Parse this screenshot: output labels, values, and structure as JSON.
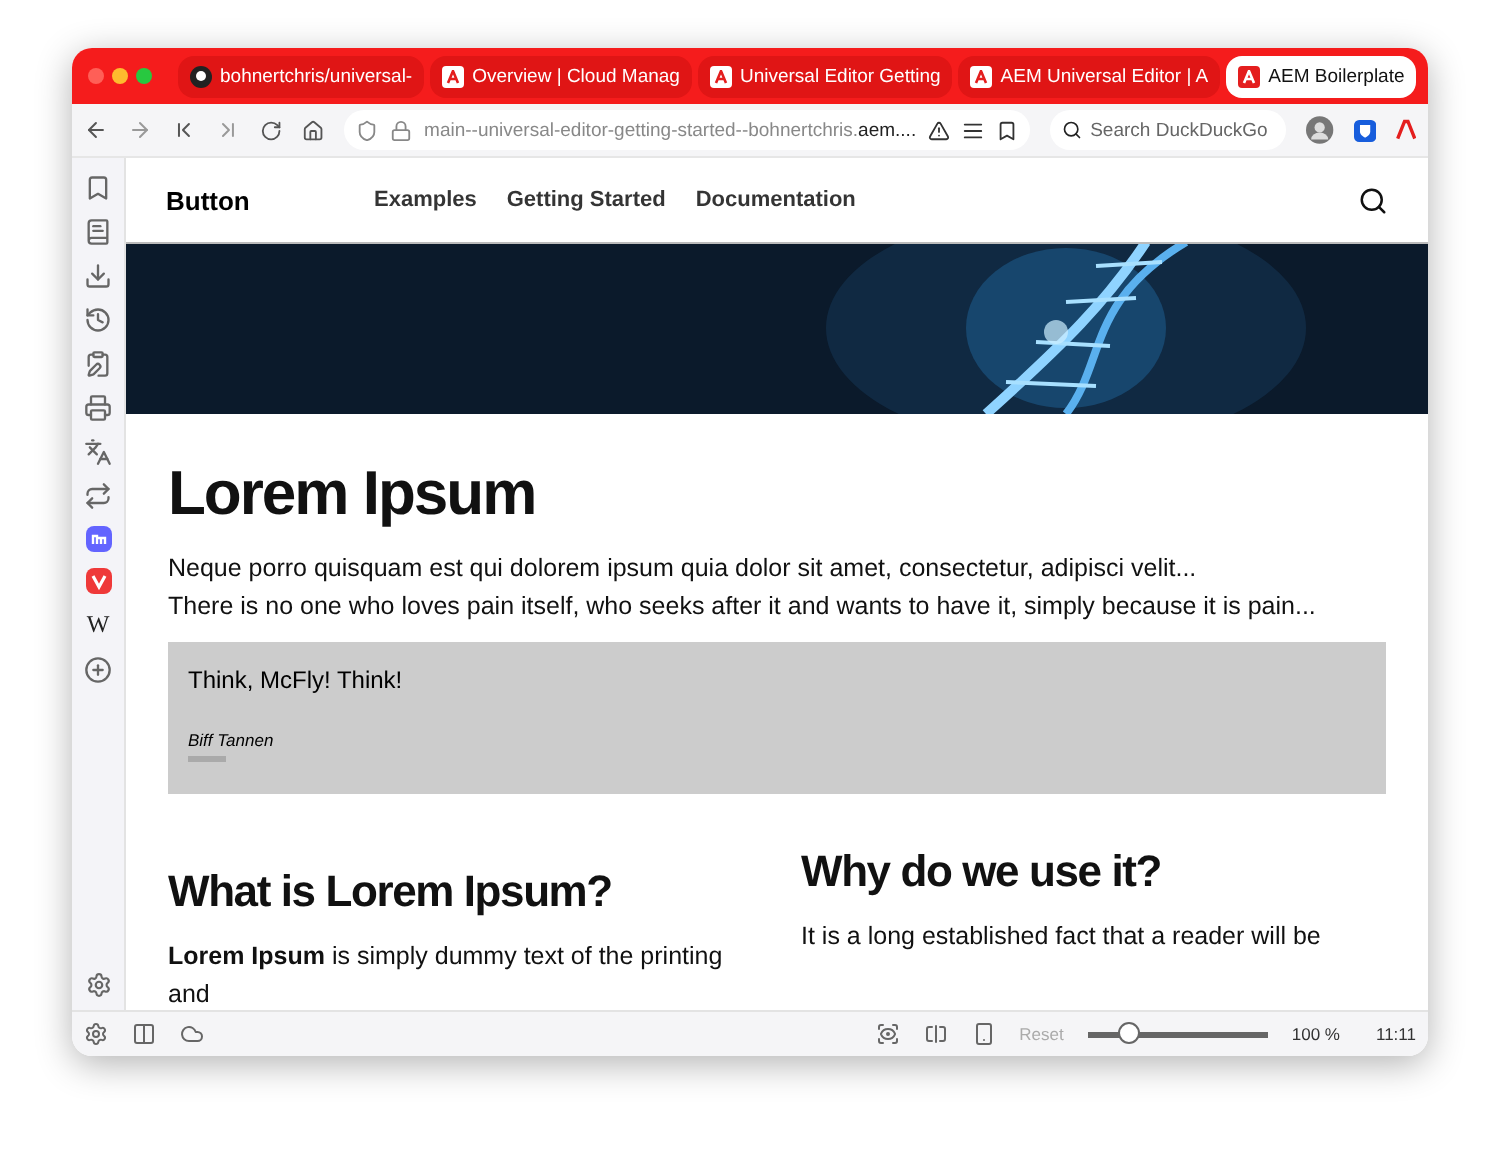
{
  "tabs": [
    {
      "label": "bohnertchris/universal-",
      "selected": false
    },
    {
      "label": "Overview | Cloud Manag",
      "selected": false
    },
    {
      "label": "Universal Editor Getting",
      "selected": false
    },
    {
      "label": "AEM Universal Editor | A",
      "selected": false
    },
    {
      "label": "AEM Boilerplate",
      "selected": true
    }
  ],
  "address": {
    "url_start": "main--universal-editor-getting-started--bohnertchris.",
    "url_end": "aem...."
  },
  "search": {
    "placeholder": "Search DuckDuckGo"
  },
  "sidebar": [
    {
      "kind": "bookmarks"
    },
    {
      "kind": "reading"
    },
    {
      "kind": "downloads"
    },
    {
      "kind": "history"
    },
    {
      "kind": "notes"
    },
    {
      "kind": "print"
    },
    {
      "kind": "translate"
    },
    {
      "kind": "sync"
    },
    {
      "kind": "mastodon"
    },
    {
      "kind": "vivaldi"
    },
    {
      "kind": "wiki",
      "glyph": "W"
    },
    {
      "kind": "add"
    }
  ],
  "site": {
    "title": "Button",
    "nav": [
      "Examples",
      "Getting Started",
      "Documentation"
    ]
  },
  "page": {
    "heading": "Lorem Ipsum",
    "paragraphs": [
      "Neque porro quisquam est qui dolorem ipsum quia dolor sit amet, consectetur, adipisci velit...",
      "There is no one who loves pain itself, who seeks after it and wants to have it, simply because it is pain..."
    ],
    "quote": {
      "text": "Think, McFly! Think!",
      "author": "Biff Tannen"
    },
    "columns": [
      {
        "heading": "What is Lorem Ipsum?",
        "text": "**Lorem Ipsum**  is simply dummy text of the printing and"
      },
      {
        "heading": "Why do we use it?",
        "text": "It is a long established fact that a reader will be"
      }
    ]
  },
  "status": {
    "reset": "Reset",
    "zoom": {
      "level": 0.2
    },
    "zoom_label": "100 %",
    "time": "11:11"
  }
}
